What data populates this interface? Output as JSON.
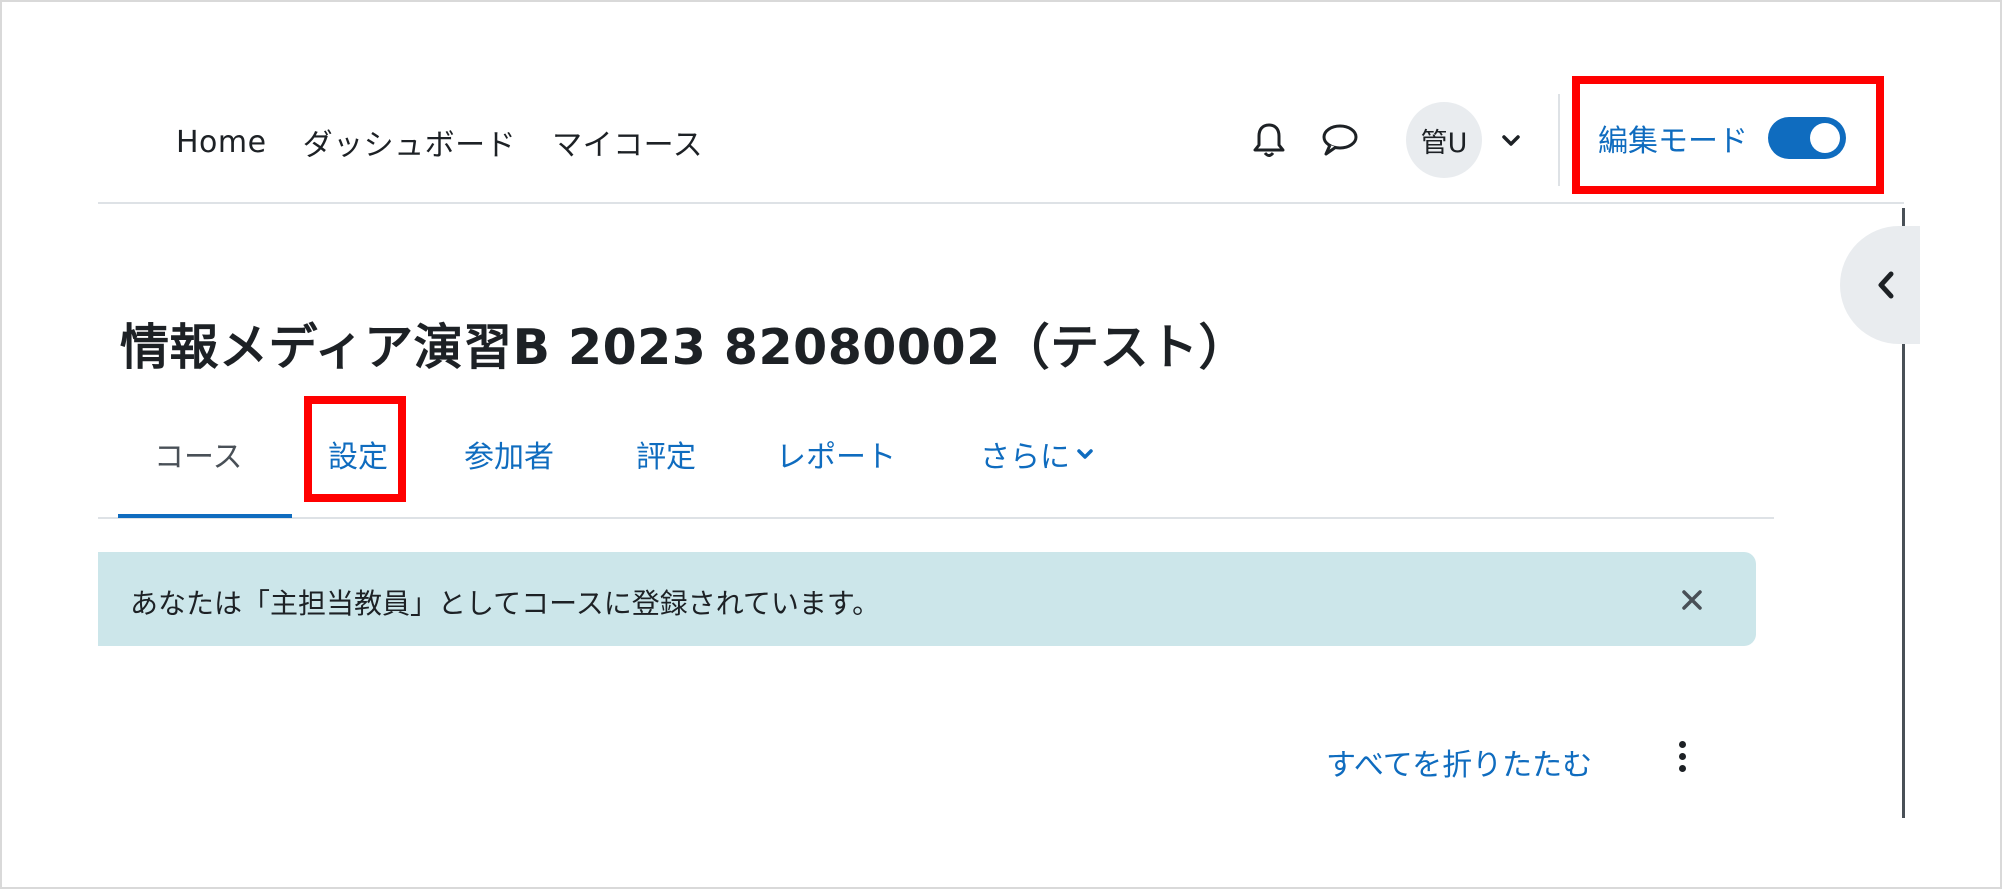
{
  "navbar": {
    "links": [
      "Home",
      "ダッシュボード",
      "マイコース"
    ],
    "avatar_initials": "管U",
    "edit_mode_label": "編集モード",
    "edit_mode_on": true
  },
  "course": {
    "title": "情報メディア演習B 2023 82080002（テスト）"
  },
  "tabs": {
    "course": "コース",
    "settings": "設定",
    "participants": "参加者",
    "grades": "評定",
    "reports": "レポート",
    "more": "さらに",
    "active": "course"
  },
  "alert": {
    "text": "あなたは「主担当教員」としてコースに登録されています。"
  },
  "content": {
    "collapse_all": "すべてを折りたたむ"
  },
  "colors": {
    "accent": "#0f6cbf",
    "alert_bg": "#cce6ea",
    "highlight": "#ff0000"
  }
}
